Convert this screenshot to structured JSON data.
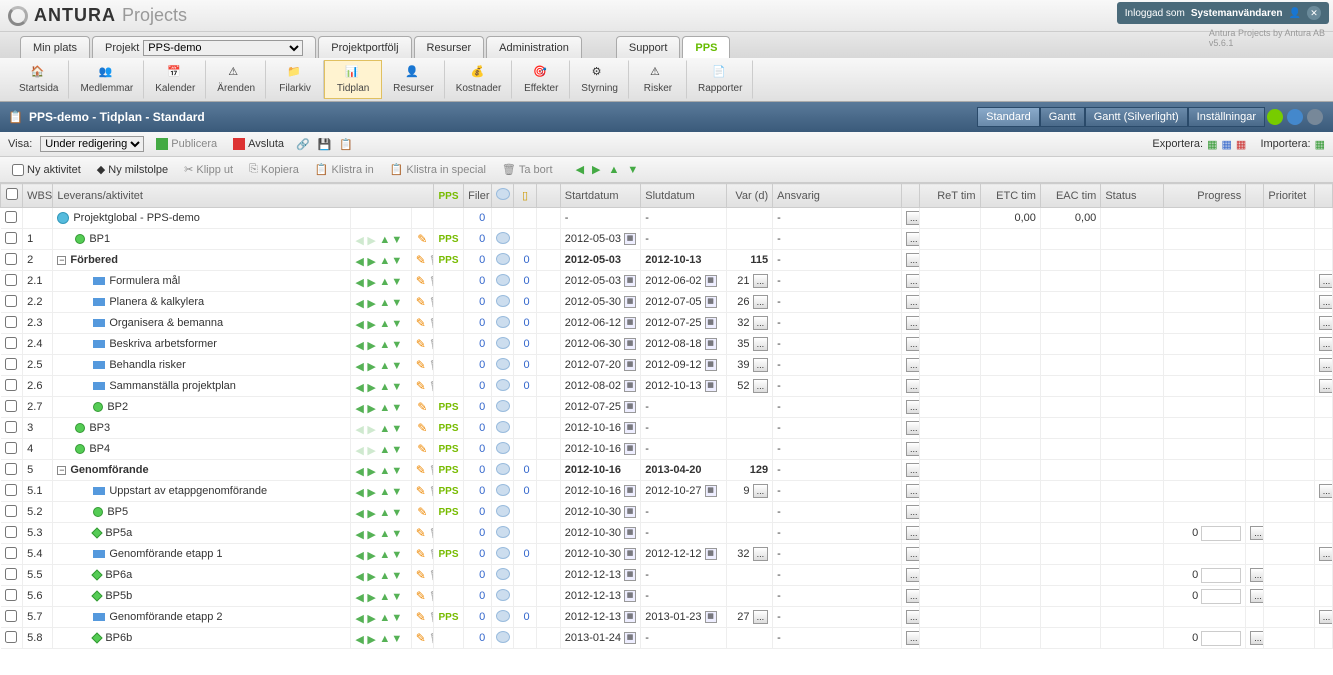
{
  "header": {
    "brand": "ANTURA",
    "product": "Projects",
    "logged_in_label": "Inloggad som",
    "user": "Systemanvändaren",
    "byline": "Antura Projects by Antura AB",
    "version": "v5.6.1"
  },
  "maintabs": {
    "minplats": "Min plats",
    "projekt_label": "Projekt",
    "projekt_value": "PPS-demo",
    "portfolio": "Projektportfölj",
    "resurser": "Resurser",
    "admin": "Administration",
    "support": "Support",
    "pps": "PPS"
  },
  "toolbar": [
    {
      "name": "startsida",
      "label": "Startsida"
    },
    {
      "name": "medlemmar",
      "label": "Medlemmar"
    },
    {
      "name": "kalender",
      "label": "Kalender"
    },
    {
      "name": "arenden",
      "label": "Ärenden"
    },
    {
      "name": "filarkiv",
      "label": "Filarkiv"
    },
    {
      "name": "tidplan",
      "label": "Tidplan"
    },
    {
      "name": "resurser2",
      "label": "Resurser"
    },
    {
      "name": "kostnader",
      "label": "Kostnader"
    },
    {
      "name": "effekter",
      "label": "Effekter"
    },
    {
      "name": "styrning",
      "label": "Styrning"
    },
    {
      "name": "risker",
      "label": "Risker"
    },
    {
      "name": "rapporter",
      "label": "Rapporter"
    }
  ],
  "subheader": {
    "title": "PPS-demo - Tidplan - Standard",
    "btns": {
      "standard": "Standard",
      "gantt": "Gantt",
      "gantt_sl": "Gantt (Silverlight)",
      "settings": "Inställningar"
    }
  },
  "actionbar": {
    "visa": "Visa:",
    "visa_val": "Under redigering",
    "publicera": "Publicera",
    "avsluta": "Avsluta",
    "exportera": "Exportera:",
    "importera": "Importera:"
  },
  "actionbar2": {
    "ny_aktivitet": "Ny aktivitet",
    "ny_milstolpe": "Ny milstolpe",
    "klipp_ut": "Klipp ut",
    "kopiera": "Kopiera",
    "klistra_in": "Klistra in",
    "klistra_special": "Klistra in special",
    "ta_bort": "Ta bort"
  },
  "cols": {
    "wbs": "WBS",
    "leverans": "Leverans/aktivitet",
    "pps": "PPS",
    "filer": "Filer",
    "start": "Startdatum",
    "slut": "Slutdatum",
    "var": "Var (d)",
    "ansvarig": "Ansvarig",
    "ret": "ReT tim",
    "etc": "ETC tim",
    "eac": "EAC tim",
    "status": "Status",
    "progress": "Progress",
    "prioritet": "Prioritet"
  },
  "rows": [
    {
      "wbs": "",
      "type": "globe",
      "name": "Projektglobal - PPS-demo",
      "indent": 0,
      "pps": false,
      "filer": "0",
      "chat": false,
      "note": "",
      "start": "-",
      "slut": "-",
      "var": "",
      "ansvarig": "-",
      "abtn": true,
      "etc": "0,00",
      "eac": "0,00",
      "arrows": false,
      "pencil": false,
      "trash": false
    },
    {
      "wbs": "1",
      "type": "gdot",
      "name": "BP1",
      "indent": 0,
      "pps": true,
      "filer": "0",
      "chat": true,
      "start": "2012-05-03",
      "scal": true,
      "slut": "-",
      "var": "",
      "ansvarig": "-",
      "abtn": true,
      "arrows": "partial"
    },
    {
      "wbs": "2",
      "type": "expand",
      "name": "Förbered",
      "indent": 0,
      "bold": true,
      "pps": true,
      "filer": "0",
      "chat": true,
      "note": "0",
      "start": "2012-05-03",
      "slut": "2012-10-13",
      "var": "115",
      "ansvarig": "-",
      "abtn": true,
      "arrows": true,
      "trash": true
    },
    {
      "wbs": "2.1",
      "type": "brect",
      "name": "Formulera mål",
      "indent": 1,
      "pps": false,
      "filer": "0",
      "chat": true,
      "note": "0",
      "start": "2012-05-03",
      "scal": true,
      "slut": "2012-06-02",
      "ecal": true,
      "var": "21",
      "vbtn": true,
      "ansvarig": "-",
      "abtn": true,
      "arrows": true,
      "trash": true,
      "pri": true
    },
    {
      "wbs": "2.2",
      "type": "brect",
      "name": "Planera & kalkylera",
      "indent": 1,
      "pps": false,
      "filer": "0",
      "chat": true,
      "note": "0",
      "start": "2012-05-30",
      "scal": true,
      "slut": "2012-07-05",
      "ecal": true,
      "var": "26",
      "vbtn": true,
      "ansvarig": "-",
      "abtn": true,
      "arrows": true,
      "trash": true,
      "pri": true
    },
    {
      "wbs": "2.3",
      "type": "brect",
      "name": "Organisera & bemanna",
      "indent": 1,
      "pps": false,
      "filer": "0",
      "chat": true,
      "note": "0",
      "start": "2012-06-12",
      "scal": true,
      "slut": "2012-07-25",
      "ecal": true,
      "var": "32",
      "vbtn": true,
      "ansvarig": "-",
      "abtn": true,
      "arrows": true,
      "trash": true,
      "pri": true
    },
    {
      "wbs": "2.4",
      "type": "brect",
      "name": "Beskriva arbetsformer",
      "indent": 1,
      "pps": false,
      "filer": "0",
      "chat": true,
      "note": "0",
      "start": "2012-06-30",
      "scal": true,
      "slut": "2012-08-18",
      "ecal": true,
      "var": "35",
      "vbtn": true,
      "ansvarig": "-",
      "abtn": true,
      "arrows": true,
      "trash": true,
      "pri": true
    },
    {
      "wbs": "2.5",
      "type": "brect",
      "name": "Behandla risker",
      "indent": 1,
      "pps": false,
      "filer": "0",
      "chat": true,
      "note": "0",
      "start": "2012-07-20",
      "scal": true,
      "slut": "2012-09-12",
      "ecal": true,
      "var": "39",
      "vbtn": true,
      "ansvarig": "-",
      "abtn": true,
      "arrows": true,
      "trash": true,
      "pri": true
    },
    {
      "wbs": "2.6",
      "type": "brect",
      "name": "Sammanställa projektplan",
      "indent": 1,
      "pps": false,
      "filer": "0",
      "chat": true,
      "note": "0",
      "start": "2012-08-02",
      "scal": true,
      "slut": "2012-10-13",
      "ecal": true,
      "var": "52",
      "vbtn": true,
      "ansvarig": "-",
      "abtn": true,
      "arrows": true,
      "trash": true,
      "pri": true
    },
    {
      "wbs": "2.7",
      "type": "gdot",
      "name": "BP2",
      "indent": 1,
      "pps": true,
      "filer": "0",
      "chat": true,
      "start": "2012-07-25",
      "scal": true,
      "slut": "-",
      "var": "",
      "ansvarig": "-",
      "abtn": true,
      "arrows": true
    },
    {
      "wbs": "3",
      "type": "gdot",
      "name": "BP3",
      "indent": 0,
      "pps": true,
      "filer": "0",
      "chat": true,
      "start": "2012-10-16",
      "scal": true,
      "slut": "-",
      "var": "",
      "ansvarig": "-",
      "abtn": true,
      "arrows": "partial"
    },
    {
      "wbs": "4",
      "type": "gdot",
      "name": "BP4",
      "indent": 0,
      "pps": true,
      "filer": "0",
      "chat": true,
      "start": "2012-10-16",
      "scal": true,
      "slut": "-",
      "var": "",
      "ansvarig": "-",
      "abtn": true,
      "arrows": "partial"
    },
    {
      "wbs": "5",
      "type": "expand",
      "name": "Genomförande",
      "indent": 0,
      "bold": true,
      "pps": true,
      "filer": "0",
      "chat": true,
      "note": "0",
      "start": "2012-10-16",
      "slut": "2013-04-20",
      "var": "129",
      "ansvarig": "-",
      "abtn": true,
      "arrows": true,
      "trash": true
    },
    {
      "wbs": "5.1",
      "type": "brect",
      "name": "Uppstart av etappgenomförande",
      "indent": 1,
      "pps": true,
      "filer": "0",
      "chat": true,
      "note": "0",
      "start": "2012-10-16",
      "scal": true,
      "slut": "2012-10-27",
      "ecal": true,
      "var": "9",
      "vbtn": true,
      "ansvarig": "-",
      "abtn": true,
      "arrows": true,
      "trash": true,
      "pri": true
    },
    {
      "wbs": "5.2",
      "type": "gdot",
      "name": "BP5",
      "indent": 1,
      "pps": true,
      "filer": "0",
      "chat": true,
      "start": "2012-10-30",
      "scal": true,
      "slut": "-",
      "var": "",
      "ansvarig": "-",
      "abtn": true,
      "arrows": true
    },
    {
      "wbs": "5.3",
      "type": "gdia",
      "name": "BP5a",
      "indent": 1,
      "pps": false,
      "filer": "0",
      "chat": true,
      "start": "2012-10-30",
      "scal": true,
      "slut": "-",
      "var": "",
      "ansvarig": "-",
      "abtn": true,
      "arrows": true,
      "trash": true,
      "progress": "0",
      "pbtn": true
    },
    {
      "wbs": "5.4",
      "type": "brect",
      "name": "Genomförande etapp 1",
      "indent": 1,
      "pps": true,
      "filer": "0",
      "chat": true,
      "note": "0",
      "start": "2012-10-30",
      "scal": true,
      "slut": "2012-12-12",
      "ecal": true,
      "var": "32",
      "vbtn": true,
      "ansvarig": "-",
      "abtn": true,
      "arrows": true,
      "trash": true,
      "pri": true
    },
    {
      "wbs": "5.5",
      "type": "gdia",
      "name": "BP6a",
      "indent": 1,
      "pps": false,
      "filer": "0",
      "chat": true,
      "start": "2012-12-13",
      "scal": true,
      "slut": "-",
      "var": "",
      "ansvarig": "-",
      "abtn": true,
      "arrows": true,
      "trash": true,
      "progress": "0",
      "pbtn": true
    },
    {
      "wbs": "5.6",
      "type": "gdia",
      "name": "BP5b",
      "indent": 1,
      "pps": false,
      "filer": "0",
      "chat": true,
      "start": "2012-12-13",
      "scal": true,
      "slut": "-",
      "var": "",
      "ansvarig": "-",
      "abtn": true,
      "arrows": true,
      "trash": true,
      "progress": "0",
      "pbtn": true
    },
    {
      "wbs": "5.7",
      "type": "brect",
      "name": "Genomförande etapp 2",
      "indent": 1,
      "pps": true,
      "filer": "0",
      "chat": true,
      "note": "0",
      "start": "2012-12-13",
      "scal": true,
      "slut": "2013-01-23",
      "ecal": true,
      "var": "27",
      "vbtn": true,
      "ansvarig": "-",
      "abtn": true,
      "arrows": true,
      "trash": true,
      "pri": true
    },
    {
      "wbs": "5.8",
      "type": "gdia",
      "name": "BP6b",
      "indent": 1,
      "pps": false,
      "filer": "0",
      "chat": true,
      "start": "2013-01-24",
      "scal": true,
      "slut": "-",
      "var": "",
      "ansvarig": "-",
      "abtn": true,
      "arrows": true,
      "trash": true,
      "progress": "0",
      "pbtn": true
    }
  ]
}
